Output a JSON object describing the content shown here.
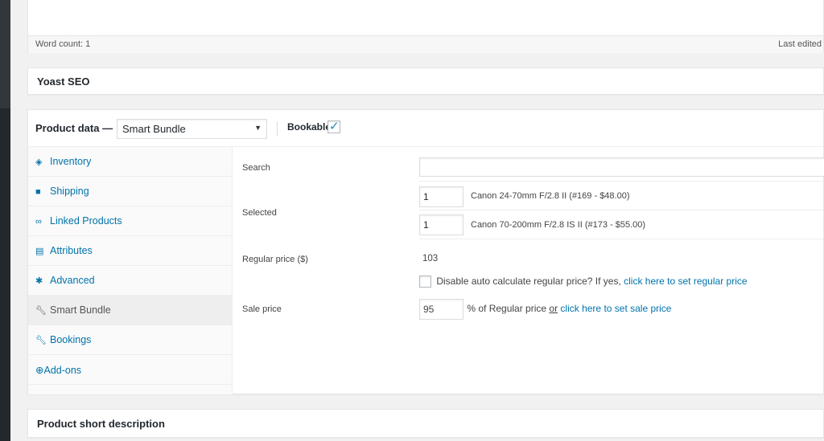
{
  "editor": {
    "word_count": "Word count: 1",
    "last_edited": "Last edited"
  },
  "yoast": {
    "title": "Yoast SEO"
  },
  "product_data": {
    "title": "Product data —",
    "type_selected": "Smart Bundle",
    "bookable_label": "Bookable:",
    "bookable_checked": true,
    "tabs": [
      {
        "label": "Inventory",
        "icon": "diamond-icon"
      },
      {
        "label": "Shipping",
        "icon": "truck-icon"
      },
      {
        "label": "Linked Products",
        "icon": "link-icon"
      },
      {
        "label": "Attributes",
        "icon": "list-icon"
      },
      {
        "label": "Advanced",
        "icon": "gear-icon"
      },
      {
        "label": "Smart Bundle",
        "icon": "wrench-icon",
        "active": true
      },
      {
        "label": "Bookings",
        "icon": "wrench-icon"
      },
      {
        "label": "Add-ons",
        "icon": "plus-circle-icon"
      }
    ],
    "panel": {
      "search_label": "Search",
      "search_value": "",
      "selected_label": "Selected",
      "selected_items": [
        {
          "qty": "1",
          "name": "Canon 24-70mm F/2.8 II (#169 - $48.00)"
        },
        {
          "qty": "1",
          "name": "Canon 70-200mm F/2.8 IS II (#173 - $55.00)"
        }
      ],
      "regular_price_label": "Regular price ($)",
      "regular_price_value": "103",
      "disable_auto_text": "Disable auto calculate regular price? If yes,",
      "disable_auto_link": "click here to set regular price",
      "sale_price_label": "Sale price",
      "sale_price_value": "95",
      "sale_suffix_text": "% of Regular price",
      "sale_or": "or",
      "sale_link": "click here to set sale price"
    }
  },
  "short_description": {
    "title": "Product short description"
  }
}
